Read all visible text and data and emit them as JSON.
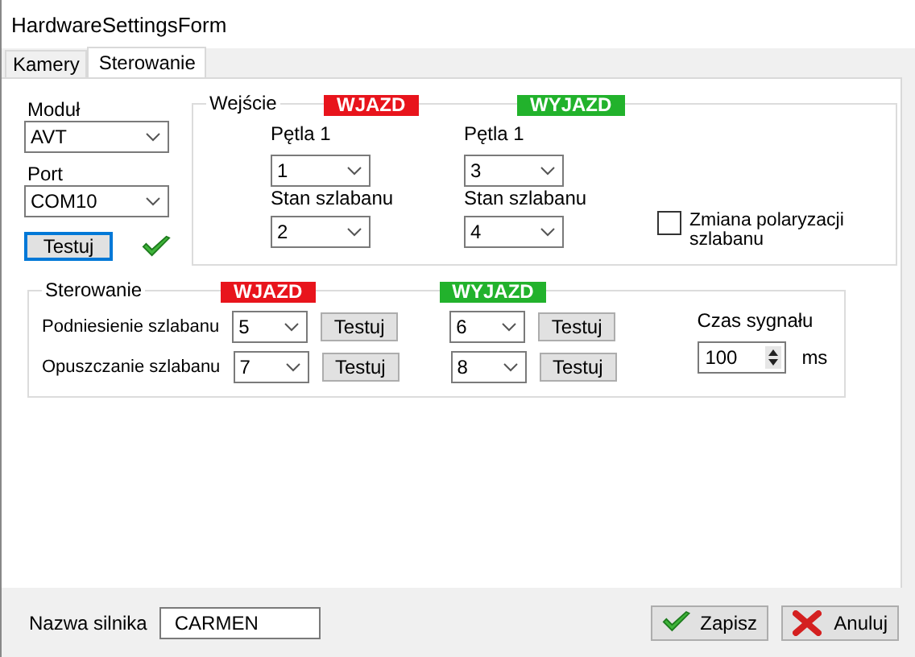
{
  "window": {
    "title": "HardwareSettingsForm"
  },
  "tabs": [
    {
      "label": "Kamery",
      "selected": false
    },
    {
      "label": "Sterowanie",
      "selected": true
    }
  ],
  "module": {
    "label": "Moduł",
    "value": "AVT"
  },
  "port": {
    "label": "Port",
    "value": "COM10"
  },
  "test_button": {
    "label": "Testuj",
    "ok": true
  },
  "inputs_group": {
    "title": "Wejście",
    "polarity": {
      "label": "Zmiana polaryzacji szlabanu",
      "checked": false
    },
    "sides": [
      {
        "badge": "WJAZD",
        "color": "#e8141c",
        "loop_label": "Pętla 1",
        "loop_value": "1",
        "state_label": "Stan szlabanu",
        "state_value": "2"
      },
      {
        "badge": "WYJAZD",
        "color": "#22b22c",
        "loop_label": "Pętla 1",
        "loop_value": "3",
        "state_label": "Stan szlabanu",
        "state_value": "4"
      }
    ]
  },
  "control_group": {
    "title": "Sterowanie",
    "badges": [
      {
        "text": "WJAZD",
        "color": "#e8141c"
      },
      {
        "text": "WYJAZD",
        "color": "#22b22c"
      }
    ],
    "rows": [
      {
        "label": "Podniesienie szlabanu",
        "values": [
          "5",
          "6"
        ],
        "buttons": [
          "Testuj",
          "Testuj"
        ]
      },
      {
        "label": "Opuszczanie szlabanu",
        "values": [
          "7",
          "8"
        ],
        "buttons": [
          "Testuj",
          "Testuj"
        ]
      }
    ],
    "signal": {
      "label": "Czas sygnału",
      "value": "100",
      "unit": "ms"
    }
  },
  "engine": {
    "label": "Nazwa silnika",
    "value": "CARMEN"
  },
  "buttons": [
    {
      "kind": "save",
      "label": "Zapisz"
    },
    {
      "kind": "cancel",
      "label": "Anuluj"
    }
  ]
}
